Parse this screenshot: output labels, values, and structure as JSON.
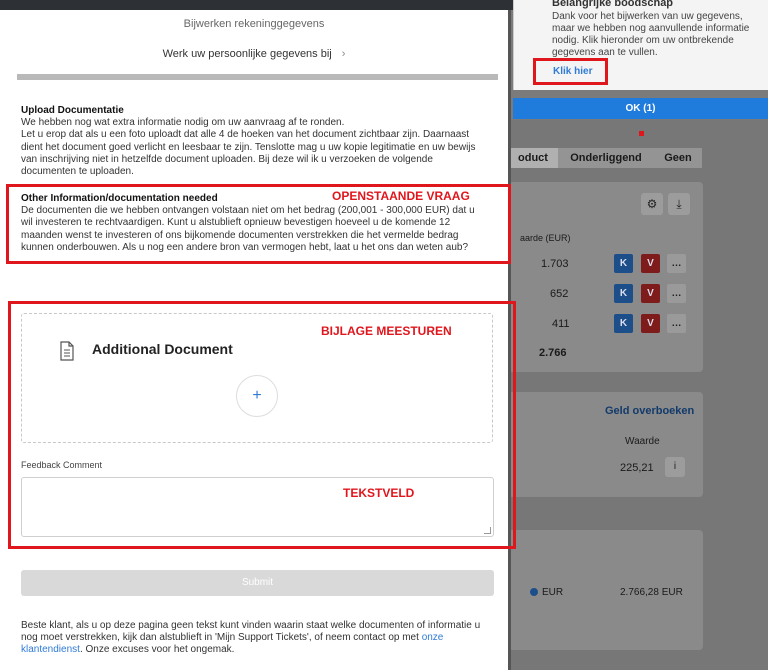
{
  "background": {
    "tabs": [
      "oduct",
      "Onderliggend",
      "Geen"
    ],
    "col_header": "aarde (EUR)",
    "rows": [
      {
        "value": "1.703",
        "k": "K",
        "v": "V",
        "more": "…"
      },
      {
        "value": "652",
        "k": "K",
        "v": "V",
        "more": "…"
      },
      {
        "value": "411",
        "k": "K",
        "v": "V",
        "more": "…"
      }
    ],
    "total": "2.766",
    "geld_overboeken": "Geld overboeken",
    "waarde_label": "Waarde",
    "waarde_value": "225,21",
    "info_btn": "i",
    "currency": "EUR",
    "currency_total": "2.766,28 EUR",
    "gear_icon": "gear-icon",
    "download_icon": "download-icon"
  },
  "modal": {
    "title": "Bijwerken rekeninggegevens",
    "subtitle": "Werk uw persoonlijke gegevens bij",
    "progress": 1.0,
    "upload": {
      "heading": "Upload Documentatie",
      "lines": [
        "We hebben nog wat extra informatie nodig om uw aanvraag af te ronden.",
        "Let u erop dat als u een foto uploadt dat alle 4 de hoeken van het document zichtbaar zijn. Daarnaast",
        "dient het document goed verlicht en leesbaar te zijn. Tenslotte mag u uw kopie legitimatie en uw bewijs",
        "van inschrijving niet in hetzelfde document uploaden. Bij deze wil ik u verzoeken de volgende",
        "documenten te uploaden."
      ]
    },
    "other": {
      "heading": "Other Information/documentation needed",
      "lines": [
        "De documenten die we hebben ontvangen volstaan niet om het bedrag (200,001 - 300,000 EUR) dat u",
        "wil investeren te rechtvaardigen. Kunt u alstublieft opnieuw bevestigen hoeveel u de komende 12",
        "maanden wenst te investeren of ons bijkomende documenten verstrekken die het vermelde bedrag",
        "kunnen onderbouwen. Als u nog een andere bron van vermogen hebt, laat u het ons dan weten aub?"
      ]
    },
    "annot_question": "OPENSTAANDE VRAAG",
    "annot_attachment": "BIJLAGE MEESTUREN",
    "annot_textfield": "TEKSTVELD",
    "additional_document": "Additional Document",
    "plus": "+",
    "feedback_label": "Feedback Comment",
    "submit": "Submit",
    "footer_text": "Beste klant, als u op deze pagina geen tekst kunt vinden waarin staat welke documenten of informatie u nog moet verstrekken, kijk dan alstublieft in 'Mijn Support Tickets', of neem contact op met ",
    "footer_link": "onze klantendienst",
    "footer_end": ". Onze excuses voor het ongemak."
  },
  "notification": {
    "title": "Belangrijke boodschap",
    "body": "Dank voor het bijwerken van uw gegevens, maar we hebben nog aanvullende informatie nodig. Klik hieronder om uw ontbrekende gegevens aan te vullen.",
    "link": "Klik hier",
    "ok": "OK (1)"
  },
  "colors": {
    "accent": "#1f7bdc",
    "annotation_red": "#e0161d"
  }
}
